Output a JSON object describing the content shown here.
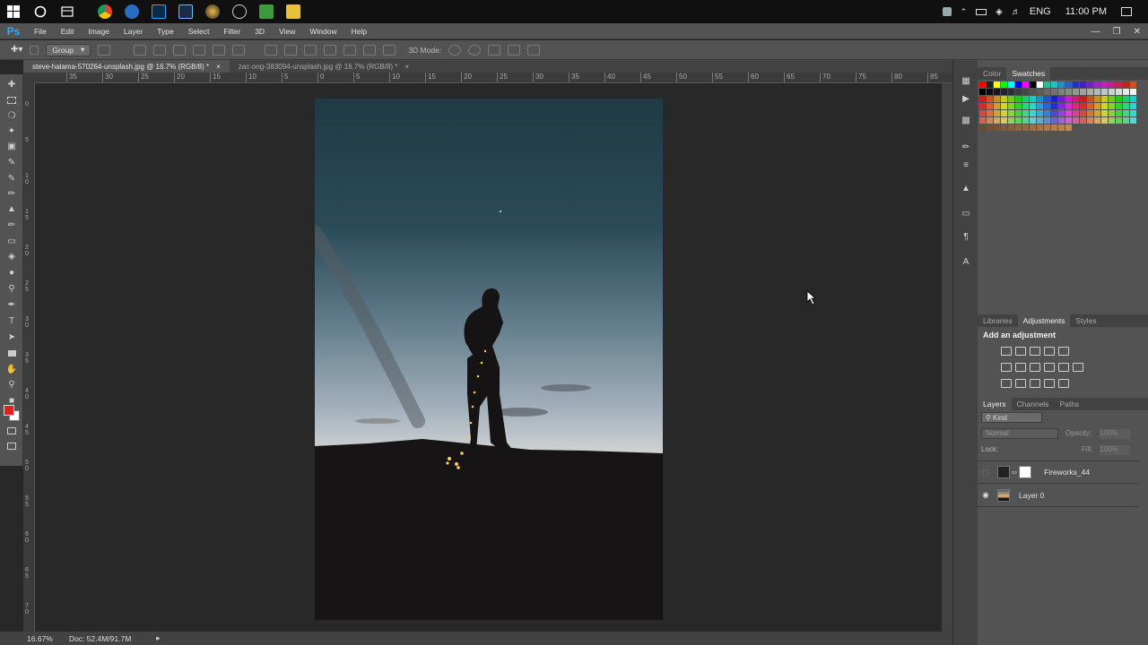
{
  "menu": {
    "logo": "Ps",
    "items": [
      "File",
      "Edit",
      "Image",
      "Layer",
      "Type",
      "Select",
      "Filter",
      "3D",
      "View",
      "Window",
      "Help"
    ]
  },
  "taskbar": {
    "language": "ENG",
    "time": "11:00 PM"
  },
  "options": {
    "auto_select_value": "Group",
    "mode_label": "3D Mode:"
  },
  "documents": [
    {
      "title": "steve-halama-570264-unsplash.jpg @ 16.7% (RGB/8) *",
      "active": true
    },
    {
      "title": "zac-ong-383094-unsplash.jpg @ 16.7% (RGB/8) *",
      "active": false
    }
  ],
  "ruler_h": [
    "35",
    "30",
    "25",
    "20",
    "15",
    "10",
    "5",
    "0",
    "5",
    "10",
    "15",
    "20",
    "25",
    "30",
    "35",
    "40",
    "45",
    "50",
    "55",
    "60",
    "65",
    "70",
    "75",
    "80",
    "85"
  ],
  "ruler_v": [
    "0",
    "5",
    "1 0",
    "1 5",
    "2 0",
    "2 5",
    "3 0",
    "3 5",
    "4 0",
    "4 5",
    "5 0",
    "5 5",
    "6 0",
    "6 5",
    "7 0"
  ],
  "status": {
    "zoom": "16.67%",
    "doc": "Doc: 52.4M/91.7M"
  },
  "panels": {
    "color_tabs": [
      "Color",
      "Swatches"
    ],
    "color_active": "Swatches",
    "adj_tabs": [
      "Libraries",
      "Adjustments",
      "Styles"
    ],
    "adj_active": "Adjustments",
    "adj_heading": "Add an adjustment",
    "layer_tabs": [
      "Layers",
      "Channels",
      "Paths"
    ],
    "layer_active": "Layers",
    "kind_label": "Kind",
    "blend_mode": "Normal",
    "opacity_label": "Opacity:",
    "opacity_value": "100%",
    "lock_label": "Lock:",
    "fill_label": "Fill:",
    "fill_value": "100%",
    "layers": [
      {
        "name": "Fireworks_44",
        "visible": false
      },
      {
        "name": "Layer 0",
        "visible": true
      }
    ]
  },
  "colors": {
    "accent": "#31a8ff",
    "foreground_swatch": "#e81c1c",
    "background_swatch": "#ffffff"
  }
}
